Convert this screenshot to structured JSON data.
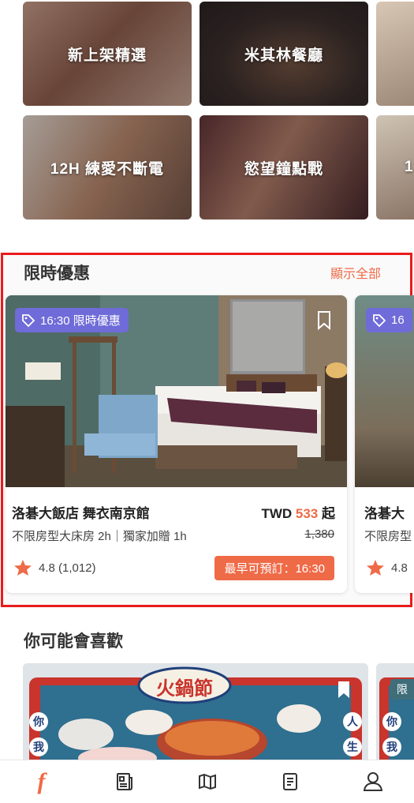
{
  "categories": [
    {
      "label": "新上架精選"
    },
    {
      "label": "米其林餐廳"
    },
    {
      "label": "12H 練愛不斷電"
    },
    {
      "label": "慾望鐘點戰"
    }
  ],
  "limited_offers": {
    "title": "限時優惠",
    "show_all": "顯示全部",
    "card": {
      "badge": "16:30 限時優惠",
      "name": "洛碁大飯店 舞衣南京館",
      "price_prefix": "TWD",
      "price": "533",
      "price_suffix": "起",
      "room": "不限房型大床房 2h｜獨家加贈 1h",
      "original_price": "1,380",
      "rating": "4.8 (1,012)",
      "book_label": "最早可預訂：16:30"
    },
    "next_card": {
      "badge": "16",
      "name": "洛碁大",
      "room": "不限房型",
      "rating": "4.8"
    }
  },
  "recommend": {
    "title": "你可能會喜歡",
    "promo_title": "火鍋節",
    "promo_left": [
      "你",
      "我"
    ],
    "promo_right": [
      "人",
      "生"
    ],
    "next_badge": "限"
  },
  "colors": {
    "accent": "#ef6a47",
    "badge": "#6f6bd8",
    "frame": "#ea1b1b"
  },
  "tabbar": {
    "icons": [
      "fb-logo-icon",
      "news-icon",
      "map-icon",
      "orders-icon",
      "profile-icon"
    ]
  }
}
